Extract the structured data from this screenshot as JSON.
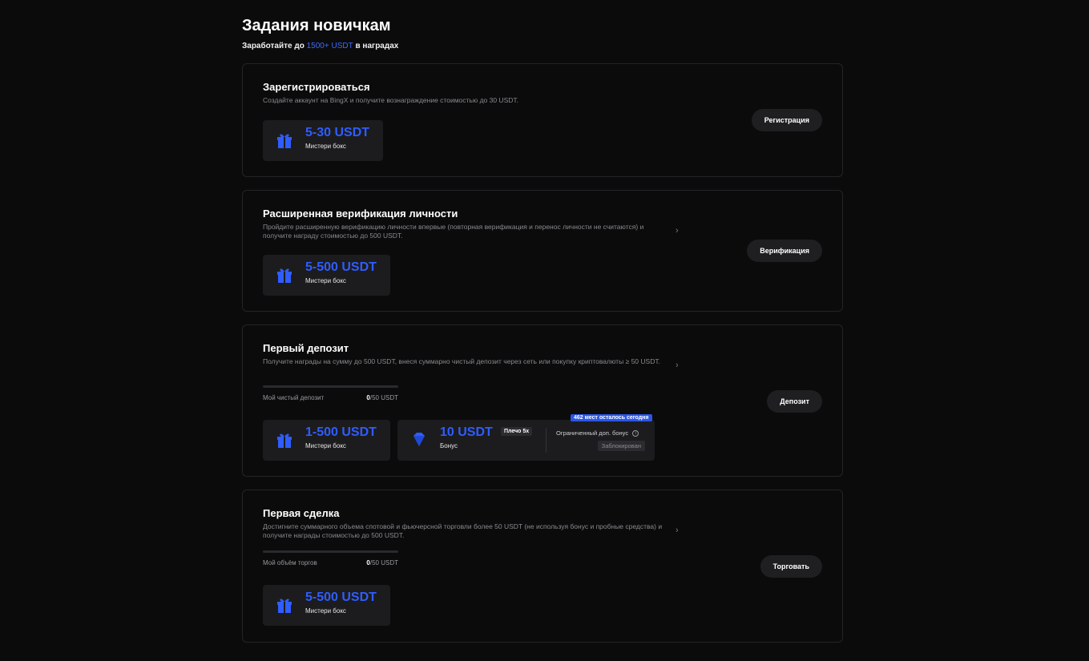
{
  "header": {
    "title": "Задания новичкам",
    "subtitle_pre": "Заработайте до",
    "subtitle_highlight": "1500+ USDT",
    "subtitle_post": "в наградах"
  },
  "tasks": [
    {
      "title": "Зарегистрироваться",
      "description": "Создайте аккаунт на BingX и получите вознаграждение стоимостью до 30 USDT.",
      "button": "Регистрация",
      "reward_amount": "5-30 USDT",
      "reward_label": "Мистери бокс"
    },
    {
      "title": "Расширенная верификация личности",
      "description": "Пройдите расширенную верификацию личности впервые (повторная верификация и перенос личности не считаются) и получите награду стоимостью до 500 USDT.",
      "button": "Верификация",
      "reward_amount": "5-500 USDT",
      "reward_label": "Мистери бокс"
    },
    {
      "title": "Первый депозит",
      "description": "Получите награды на сумму до 500 USDT, внеся суммарно чистый депозит через сеть или покупку криптовалюты ≥ 50 USDT.",
      "button": "Депозит",
      "progress_label": "Мой чистый депозит",
      "progress_current": "0",
      "progress_target": "/50 USDT",
      "progress_fraction": 0,
      "reward_amount": "1-500 USDT",
      "reward_label": "Мистери бокс",
      "bonus": {
        "amount": "10 USDT",
        "leverage": "Плечо 5x",
        "label": "Бонус",
        "limited_label": "Ограниченный доп. бонус",
        "info_icon": "info-icon",
        "status": "Заблокирован",
        "seats_badge": "462 мест осталось сегодня"
      }
    },
    {
      "title": "Первая сделка",
      "description": "Достигните суммарного объема спотовой и фьючерсной торговли более 50 USDT (не используя бонус и пробные средства) и получите награды стоимостью до 500 USDT.",
      "button": "Торговать",
      "progress_label": "Мой объём торгов",
      "progress_current": "0",
      "progress_target": "/50 USDT",
      "progress_fraction": 0,
      "reward_amount": "5-500 USDT",
      "reward_label": "Мистери бокс"
    }
  ],
  "colors": {
    "accent": "#2f5dff",
    "background": "#0b0b0c",
    "card_border": "#242428",
    "reward_bg": "#1c1c1e"
  }
}
